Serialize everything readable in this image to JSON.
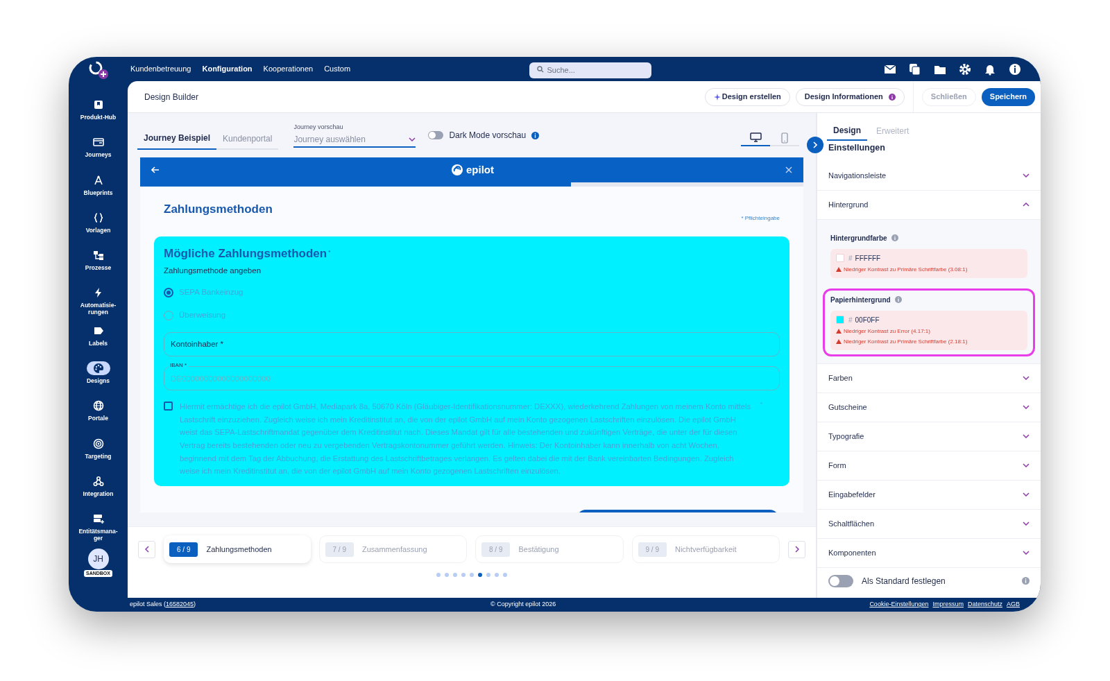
{
  "top_nav": {
    "links": [
      {
        "label": "Kundenbetreuung",
        "selected": false
      },
      {
        "label": "Konfiguration",
        "selected": true
      },
      {
        "label": "Kooperationen",
        "selected": false
      },
      {
        "label": "Custom",
        "selected": false
      }
    ],
    "search": {
      "placeholder": "Suche..."
    }
  },
  "sidebar": {
    "items": [
      {
        "label": "Produkt-Hub",
        "selected": false
      },
      {
        "label": "Journeys",
        "selected": false
      },
      {
        "label": "Blueprints",
        "selected": false
      },
      {
        "label": "Vorlagen",
        "selected": false
      },
      {
        "label": "Prozesse",
        "selected": false
      },
      {
        "label": "Automatisie-\nrungen",
        "selected": false
      },
      {
        "label": "Labels",
        "selected": false
      },
      {
        "label": "Designs",
        "selected": true
      },
      {
        "label": "Portale",
        "selected": false
      },
      {
        "label": "Targeting",
        "selected": false
      },
      {
        "label": "Integration",
        "selected": false
      },
      {
        "label": "Entitätsmana-\nger",
        "selected": false
      }
    ],
    "avatar": {
      "initials": "JH",
      "badge": "SANDBOX"
    }
  },
  "header": {
    "title": "Design Builder",
    "create_button": "Design erstellen",
    "info_button": "Design Informationen",
    "close_button": "Schließen",
    "save_button": "Speichern"
  },
  "preview": {
    "tabs": [
      {
        "label": "Journey Beispiel",
        "selected": true
      },
      {
        "label": "Kundenportal",
        "selected": false
      }
    ],
    "journey_select": {
      "label": "Journey vorschau",
      "placeholder": "Journey auswählen"
    },
    "dark_mode": {
      "label": "Dark Mode vorschau",
      "on": false
    },
    "devices": [
      {
        "kind": "desktop",
        "selected": true
      },
      {
        "kind": "mobile",
        "selected": false
      }
    ]
  },
  "journey": {
    "logo": "epilot",
    "progress": {
      "level": 0.65
    },
    "step_title": "Zahlungsmethoden",
    "required_note": "* Pflichteingabe",
    "card": {
      "title": "Mögliche Zahlungsmethoden",
      "required_mark": "*",
      "subtitle": "Zahlungsmethode angeben",
      "options": [
        {
          "label": "SEPA Bankeinzug",
          "selected": true
        },
        {
          "label": "Überweisung",
          "selected": false
        }
      ],
      "fields": [
        {
          "label": "Kontoinhaber *"
        },
        {
          "label": "IBAN *",
          "placeholder": "DE00000000000000000000"
        }
      ],
      "consent": {
        "checked": false,
        "required_mark": "*",
        "text": "Hiermit ermächtige ich die epilot GmbH, Mediapark 8a, 50670 Köln (Gläubiger-Identifikationsnummer: DEXXX), wiederkehrend Zahlungen von meinem Konto mittels Lastschrift einzuziehen. Zugleich weise ich mein Kreditinstitut an, die von der epilot GmbH auf mein Konto gezogenen Lastschriften einzulösen. Die epilot GmbH weist das SEPA-Lastschriftmandat gegenüber dem Kreditinstitut nach. Dieses Mandat gilt für alle bestehenden und zukünftigen Verträge, die unter der für diesen Vertrag bereits bestehenden oder neu zu vergebenden Vertragskontonummer geführt werden. Hinweis: Der Kontoinhaber kann innerhalb von acht Wochen, beginnend mit dem Tag der Abbuchung, die Erstattung des Lastschriftbetrages verlangen. Es gelten dabei die mit der Bank vereinbarten Bedingungen. Zugleich weise ich mein Kreditinstitut an, die von der epilot GmbH auf mein Konto gezogenen Lastschriften einzulösen."
      }
    }
  },
  "stepper": {
    "steps": [
      {
        "number": "6 / 9",
        "label": "Zahlungsmethoden",
        "selected": true
      },
      {
        "number": "7 / 9",
        "label": "Zusammenfassung",
        "selected": false
      },
      {
        "number": "8 / 9",
        "label": "Bestätigung",
        "selected": false
      },
      {
        "number": "9 / 9",
        "label": "Nichtverfügbarkeit",
        "selected": false
      }
    ],
    "dots": [
      {
        "selected": false
      },
      {
        "selected": false
      },
      {
        "selected": false
      },
      {
        "selected": false
      },
      {
        "selected": false
      },
      {
        "selected": true
      },
      {
        "selected": false
      },
      {
        "selected": false
      },
      {
        "selected": false
      }
    ]
  },
  "settings": {
    "tabs": [
      {
        "label": "Design",
        "selected": true
      },
      {
        "label": "Erweitert",
        "selected": false
      }
    ],
    "heading": "Einstellungen",
    "sections": [
      {
        "label": "Navigationsleiste",
        "expanded": false
      },
      {
        "label": "Hintergrund",
        "expanded": true,
        "colors": [
          {
            "label": "Hintergrundfarbe",
            "hash": "#",
            "value": "FFFFFF",
            "color": "#ffffff",
            "highlighted": false,
            "warnings": [
              "Niedriger Kontrast zu Primäre Schriftfarbe (3.08:1)"
            ]
          },
          {
            "label": "Papierhintergrund",
            "hash": "#",
            "value": "00F0FF",
            "color": "#00f0ff",
            "highlighted": true,
            "warnings": [
              "Niedriger Kontrast zu Error (4.17:1)",
              "Niedriger Kontrast zu Primäre Schriftfarbe (2.18:1)"
            ]
          }
        ]
      },
      {
        "label": "Farben",
        "expanded": false
      },
      {
        "label": "Gutscheine",
        "expanded": false
      },
      {
        "label": "Typografie",
        "expanded": false
      },
      {
        "label": "Form",
        "expanded": false
      },
      {
        "label": "Eingabefelder",
        "expanded": false
      },
      {
        "label": "Schaltflächen",
        "expanded": false
      },
      {
        "label": "Komponenten",
        "expanded": false
      }
    ],
    "default_toggle": {
      "label": "Als Standard festlegen",
      "on": false
    }
  },
  "footer": {
    "account_prefix": "epilot Sales (",
    "account_id": "16582045",
    "account_suffix": ")",
    "copyright": "© Copyright epilot 2026",
    "links": [
      "Cookie-Einstellungen",
      "Impressum",
      "Datenschutz",
      "AGB"
    ]
  }
}
